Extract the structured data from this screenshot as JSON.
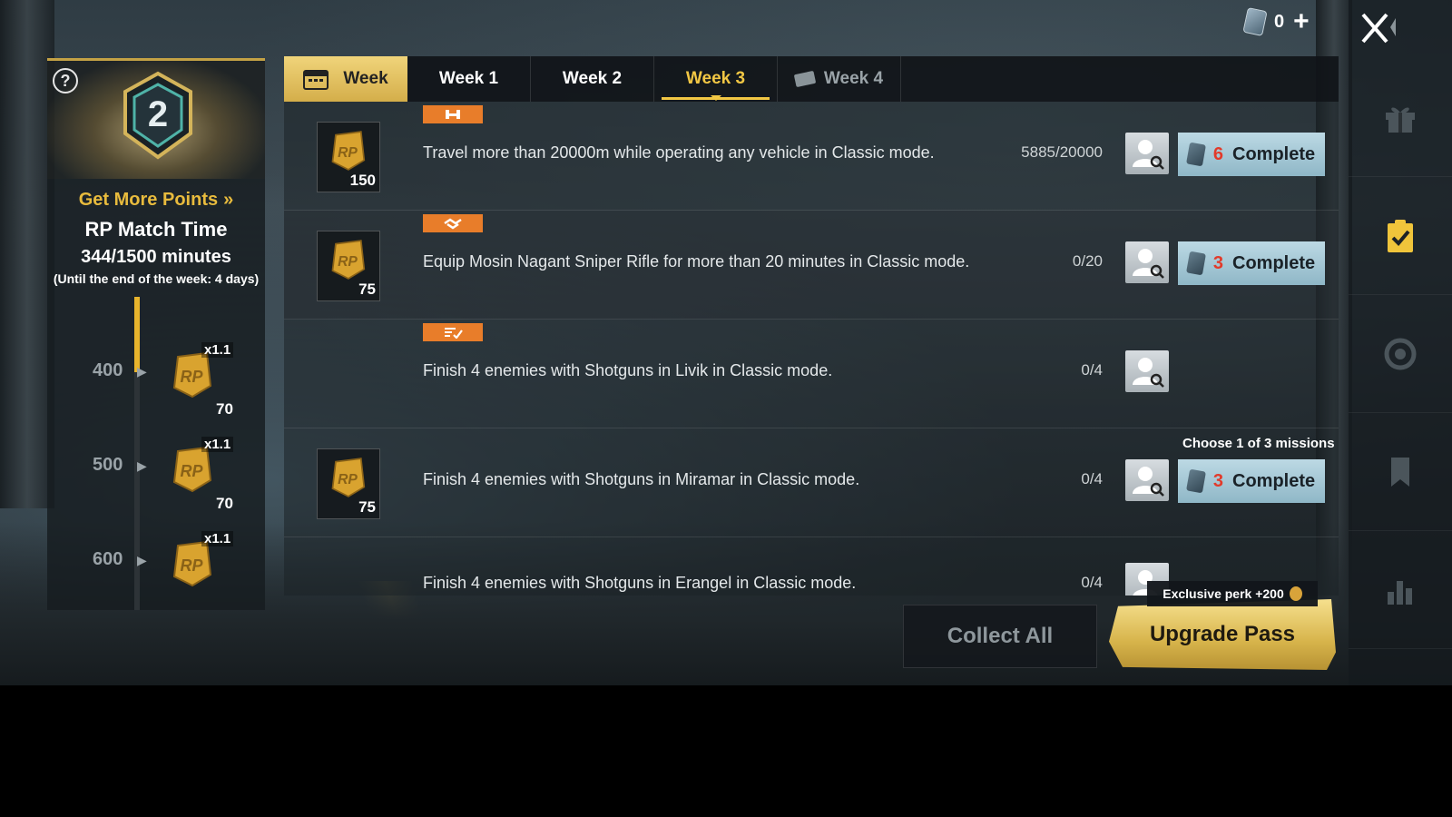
{
  "currency": {
    "count": "0",
    "icon": "coupon-icon",
    "plus": "+"
  },
  "left_panel": {
    "help": "?",
    "get_more": "Get More Points",
    "title": "RP Match Time",
    "progress": "344/1500 minutes",
    "until": "(Until the end of the week: 4 days)",
    "levels": [
      {
        "level": "400",
        "mult": "x1.1",
        "reward": "70"
      },
      {
        "level": "500",
        "mult": "x1.1",
        "reward": "70"
      },
      {
        "level": "600",
        "mult": "x1.1",
        "reward": ""
      }
    ],
    "level_fill_fraction": 0.23
  },
  "tabs": {
    "week": "Week",
    "week1": "Week 1",
    "week2": "Week 2",
    "week3": "Week 3",
    "week4": "Week 4",
    "selected": "Week 3"
  },
  "missions": [
    {
      "reward": "150",
      "desc": "Travel more than 20000m while operating any vehicle in Classic mode.",
      "progress": "5885/20000",
      "cost": "6",
      "complete": "Complete",
      "category": "vehicle"
    },
    {
      "reward": "75",
      "desc": "Equip Mosin Nagant Sniper Rifle for more than 20 minutes in Classic mode.",
      "progress": "0/20",
      "cost": "3",
      "complete": "Complete",
      "category": "handshake"
    },
    {
      "reward": "",
      "desc": "Finish 4 enemies with Shotguns in Livik in Classic mode.",
      "progress": "0/4",
      "category": "checklist"
    },
    {
      "reward": "75",
      "desc": "Finish 4 enemies with Shotguns in Miramar in Classic mode.",
      "progress": "0/4",
      "cost": "3",
      "complete": "Complete",
      "choose": "Choose 1 of 3 missions"
    },
    {
      "desc": "Finish 4 enemies with Shotguns in Erangel in Classic mode.",
      "progress": "0/4"
    }
  ],
  "actions": {
    "collect_all": "Collect All",
    "upgrade": "Upgrade Pass",
    "perk": "Exclusive perk +200"
  },
  "rail": [
    "close-icon",
    "gift-icon",
    "clipboard-check-icon",
    "refresh-icon",
    "bookmark-icon",
    "bar-chart-icon"
  ],
  "colors": {
    "accent": "#f2c744",
    "tag": "#e87d2a",
    "complete_bg": "#a6cad8",
    "cost_red": "#e23a2a"
  }
}
